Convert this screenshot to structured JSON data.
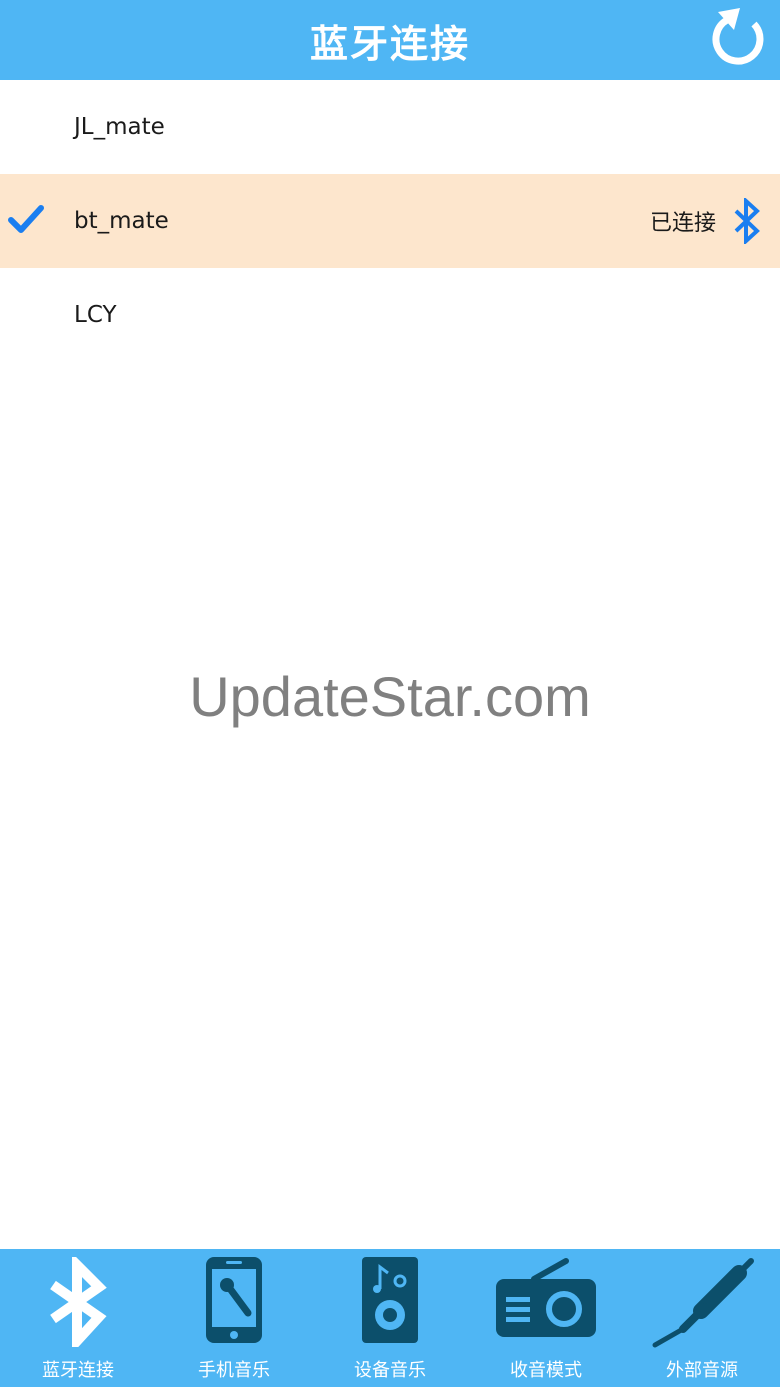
{
  "header": {
    "title": "蓝牙连接",
    "refresh_icon": "refresh-icon"
  },
  "devices": [
    {
      "name": "JL_mate",
      "selected": false,
      "status": ""
    },
    {
      "name": "bt_mate",
      "selected": true,
      "status": "已连接",
      "icon": "bluetooth-icon"
    },
    {
      "name": "LCY",
      "selected": false,
      "status": ""
    }
  ],
  "watermark": "UpdateStar.com",
  "tabs": [
    {
      "label": "蓝牙连接",
      "icon": "bluetooth-icon"
    },
    {
      "label": "手机音乐",
      "icon": "phone-microphone-icon"
    },
    {
      "label": "设备音乐",
      "icon": "speaker-icon"
    },
    {
      "label": "收音模式",
      "icon": "radio-icon"
    },
    {
      "label": "外部音源",
      "icon": "audio-cable-icon"
    }
  ],
  "colors": {
    "primary": "#4fb6f4",
    "selected_row": "#fde6cd",
    "accent_blue": "#1a7ef0",
    "tab_icon_dark": "#0c4f6b"
  }
}
